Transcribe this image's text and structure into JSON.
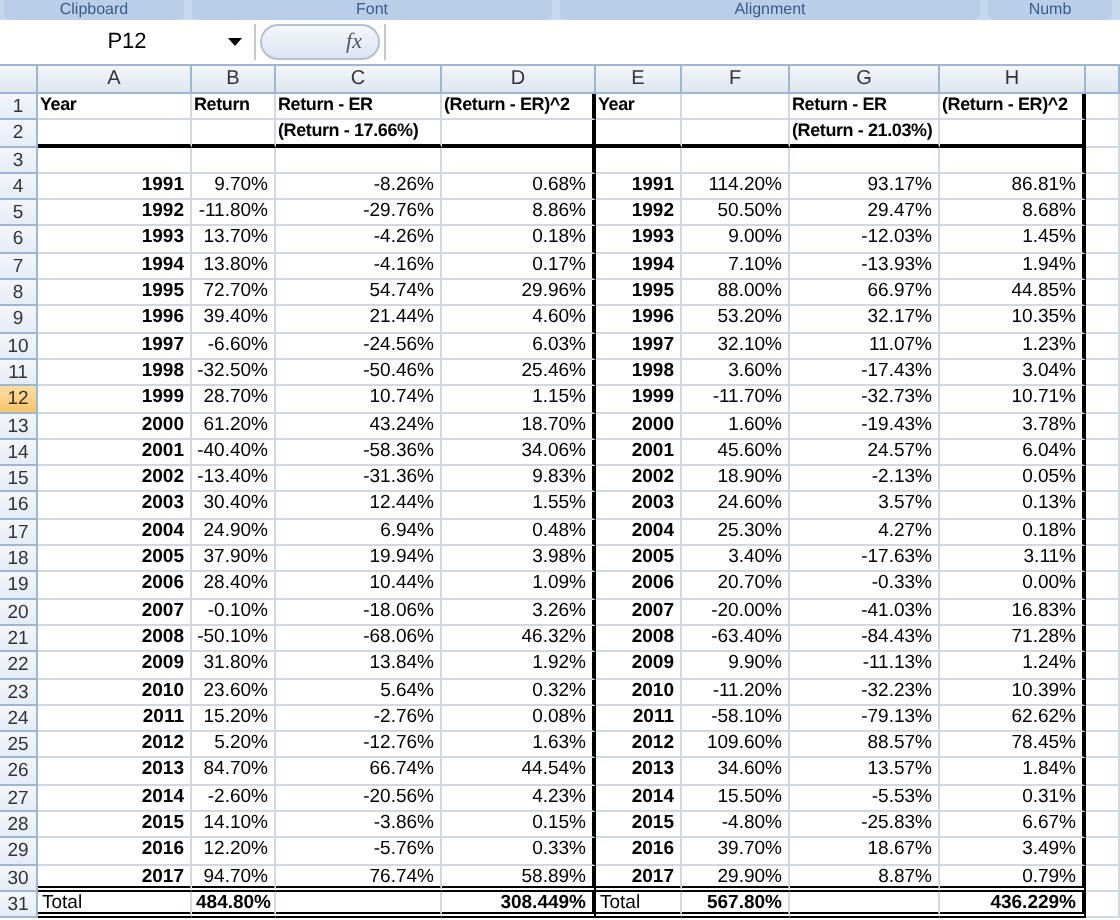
{
  "ribbon_groups": [
    "Clipboard",
    "Font",
    "Alignment",
    "Numb"
  ],
  "name_box": "P12",
  "formula_bar": {
    "fx": "fx"
  },
  "columns": [
    "A",
    "B",
    "C",
    "D",
    "E",
    "F",
    "G",
    "H"
  ],
  "rows": [
    {
      "header": "1",
      "kind": "head",
      "selected": false,
      "rule_below": false,
      "cells": [
        "Year",
        "Return",
        "Return - ER",
        "(Return - ER)^2",
        "Year",
        null,
        "Return - ER",
        "(Return - ER)^2"
      ]
    },
    {
      "header": "2",
      "kind": "head",
      "selected": false,
      "rule_below": true,
      "cells": [
        null,
        null,
        "(Return - 17.66%)",
        null,
        null,
        null,
        "(Return - 21.03%)",
        null
      ]
    },
    {
      "header": "3",
      "kind": "data",
      "selected": false,
      "rule_below": false,
      "cells": [
        null,
        null,
        null,
        null,
        null,
        null,
        null,
        null
      ]
    },
    {
      "header": "4",
      "kind": "data",
      "selected": false,
      "rule_below": false,
      "cells": [
        "1991",
        "9.70%",
        "-8.26%",
        "0.68%",
        "1991",
        "114.20%",
        "93.17%",
        "86.81%"
      ]
    },
    {
      "header": "5",
      "kind": "data",
      "selected": false,
      "rule_below": false,
      "cells": [
        "1992",
        "-11.80%",
        "-29.76%",
        "8.86%",
        "1992",
        "50.50%",
        "29.47%",
        "8.68%"
      ]
    },
    {
      "header": "6",
      "kind": "data",
      "selected": false,
      "rule_below": false,
      "cells": [
        "1993",
        "13.70%",
        "-4.26%",
        "0.18%",
        "1993",
        "9.00%",
        "-12.03%",
        "1.45%"
      ]
    },
    {
      "header": "7",
      "kind": "data",
      "selected": false,
      "rule_below": false,
      "cells": [
        "1994",
        "13.80%",
        "-4.16%",
        "0.17%",
        "1994",
        "7.10%",
        "-13.93%",
        "1.94%"
      ]
    },
    {
      "header": "8",
      "kind": "data",
      "selected": false,
      "rule_below": false,
      "cells": [
        "1995",
        "72.70%",
        "54.74%",
        "29.96%",
        "1995",
        "88.00%",
        "66.97%",
        "44.85%"
      ]
    },
    {
      "header": "9",
      "kind": "data",
      "selected": false,
      "rule_below": false,
      "cells": [
        "1996",
        "39.40%",
        "21.44%",
        "4.60%",
        "1996",
        "53.20%",
        "32.17%",
        "10.35%"
      ]
    },
    {
      "header": "10",
      "kind": "data",
      "selected": false,
      "rule_below": false,
      "cells": [
        "1997",
        "-6.60%",
        "-24.56%",
        "6.03%",
        "1997",
        "32.10%",
        "11.07%",
        "1.23%"
      ]
    },
    {
      "header": "11",
      "kind": "data",
      "selected": false,
      "rule_below": false,
      "cells": [
        "1998",
        "-32.50%",
        "-50.46%",
        "25.46%",
        "1998",
        "3.60%",
        "-17.43%",
        "3.04%"
      ]
    },
    {
      "header": "12",
      "kind": "data",
      "selected": true,
      "rule_below": false,
      "cells": [
        "1999",
        "28.70%",
        "10.74%",
        "1.15%",
        "1999",
        "-11.70%",
        "-32.73%",
        "10.71%"
      ]
    },
    {
      "header": "13",
      "kind": "data",
      "selected": false,
      "rule_below": false,
      "cells": [
        "2000",
        "61.20%",
        "43.24%",
        "18.70%",
        "2000",
        "1.60%",
        "-19.43%",
        "3.78%"
      ]
    },
    {
      "header": "14",
      "kind": "data",
      "selected": false,
      "rule_below": false,
      "cells": [
        "2001",
        "-40.40%",
        "-58.36%",
        "34.06%",
        "2001",
        "45.60%",
        "24.57%",
        "6.04%"
      ]
    },
    {
      "header": "15",
      "kind": "data",
      "selected": false,
      "rule_below": false,
      "cells": [
        "2002",
        "-13.40%",
        "-31.36%",
        "9.83%",
        "2002",
        "18.90%",
        "-2.13%",
        "0.05%"
      ]
    },
    {
      "header": "16",
      "kind": "data",
      "selected": false,
      "rule_below": false,
      "cells": [
        "2003",
        "30.40%",
        "12.44%",
        "1.55%",
        "2003",
        "24.60%",
        "3.57%",
        "0.13%"
      ]
    },
    {
      "header": "17",
      "kind": "data",
      "selected": false,
      "rule_below": false,
      "cells": [
        "2004",
        "24.90%",
        "6.94%",
        "0.48%",
        "2004",
        "25.30%",
        "4.27%",
        "0.18%"
      ]
    },
    {
      "header": "18",
      "kind": "data",
      "selected": false,
      "rule_below": false,
      "cells": [
        "2005",
        "37.90%",
        "19.94%",
        "3.98%",
        "2005",
        "3.40%",
        "-17.63%",
        "3.11%"
      ]
    },
    {
      "header": "19",
      "kind": "data",
      "selected": false,
      "rule_below": false,
      "cells": [
        "2006",
        "28.40%",
        "10.44%",
        "1.09%",
        "2006",
        "20.70%",
        "-0.33%",
        "0.00%"
      ]
    },
    {
      "header": "20",
      "kind": "data",
      "selected": false,
      "rule_below": false,
      "cells": [
        "2007",
        "-0.10%",
        "-18.06%",
        "3.26%",
        "2007",
        "-20.00%",
        "-41.03%",
        "16.83%"
      ]
    },
    {
      "header": "21",
      "kind": "data",
      "selected": false,
      "rule_below": false,
      "cells": [
        "2008",
        "-50.10%",
        "-68.06%",
        "46.32%",
        "2008",
        "-63.40%",
        "-84.43%",
        "71.28%"
      ]
    },
    {
      "header": "22",
      "kind": "data",
      "selected": false,
      "rule_below": false,
      "cells": [
        "2009",
        "31.80%",
        "13.84%",
        "1.92%",
        "2009",
        "9.90%",
        "-11.13%",
        "1.24%"
      ]
    },
    {
      "header": "23",
      "kind": "data",
      "selected": false,
      "rule_below": false,
      "cells": [
        "2010",
        "23.60%",
        "5.64%",
        "0.32%",
        "2010",
        "-11.20%",
        "-32.23%",
        "10.39%"
      ]
    },
    {
      "header": "24",
      "kind": "data",
      "selected": false,
      "rule_below": false,
      "cells": [
        "2011",
        "15.20%",
        "-2.76%",
        "0.08%",
        "2011",
        "-58.10%",
        "-79.13%",
        "62.62%"
      ]
    },
    {
      "header": "25",
      "kind": "data",
      "selected": false,
      "rule_below": false,
      "cells": [
        "2012",
        "5.20%",
        "-12.76%",
        "1.63%",
        "2012",
        "109.60%",
        "88.57%",
        "78.45%"
      ]
    },
    {
      "header": "26",
      "kind": "data",
      "selected": false,
      "rule_below": false,
      "cells": [
        "2013",
        "84.70%",
        "66.74%",
        "44.54%",
        "2013",
        "34.60%",
        "13.57%",
        "1.84%"
      ]
    },
    {
      "header": "27",
      "kind": "data",
      "selected": false,
      "rule_below": false,
      "cells": [
        "2014",
        "-2.60%",
        "-20.56%",
        "4.23%",
        "2014",
        "15.50%",
        "-5.53%",
        "0.31%"
      ]
    },
    {
      "header": "28",
      "kind": "data",
      "selected": false,
      "rule_below": false,
      "cells": [
        "2015",
        "14.10%",
        "-3.86%",
        "0.15%",
        "2015",
        "-4.80%",
        "-25.83%",
        "6.67%"
      ]
    },
    {
      "header": "29",
      "kind": "data",
      "selected": false,
      "rule_below": false,
      "cells": [
        "2016",
        "12.20%",
        "-5.76%",
        "0.33%",
        "2016",
        "39.70%",
        "18.67%",
        "3.49%"
      ]
    },
    {
      "header": "30",
      "kind": "data",
      "selected": false,
      "rule_below": false,
      "cells": [
        "2017",
        "94.70%",
        "76.74%",
        "58.89%",
        "2017",
        "29.90%",
        "8.87%",
        "0.79%"
      ]
    },
    {
      "header": "31",
      "kind": "total",
      "selected": false,
      "rule_below": false,
      "cells": [
        "Total",
        "484.80%",
        null,
        "308.449%",
        "Total",
        "567.80%",
        null,
        "436.229%"
      ]
    }
  ]
}
